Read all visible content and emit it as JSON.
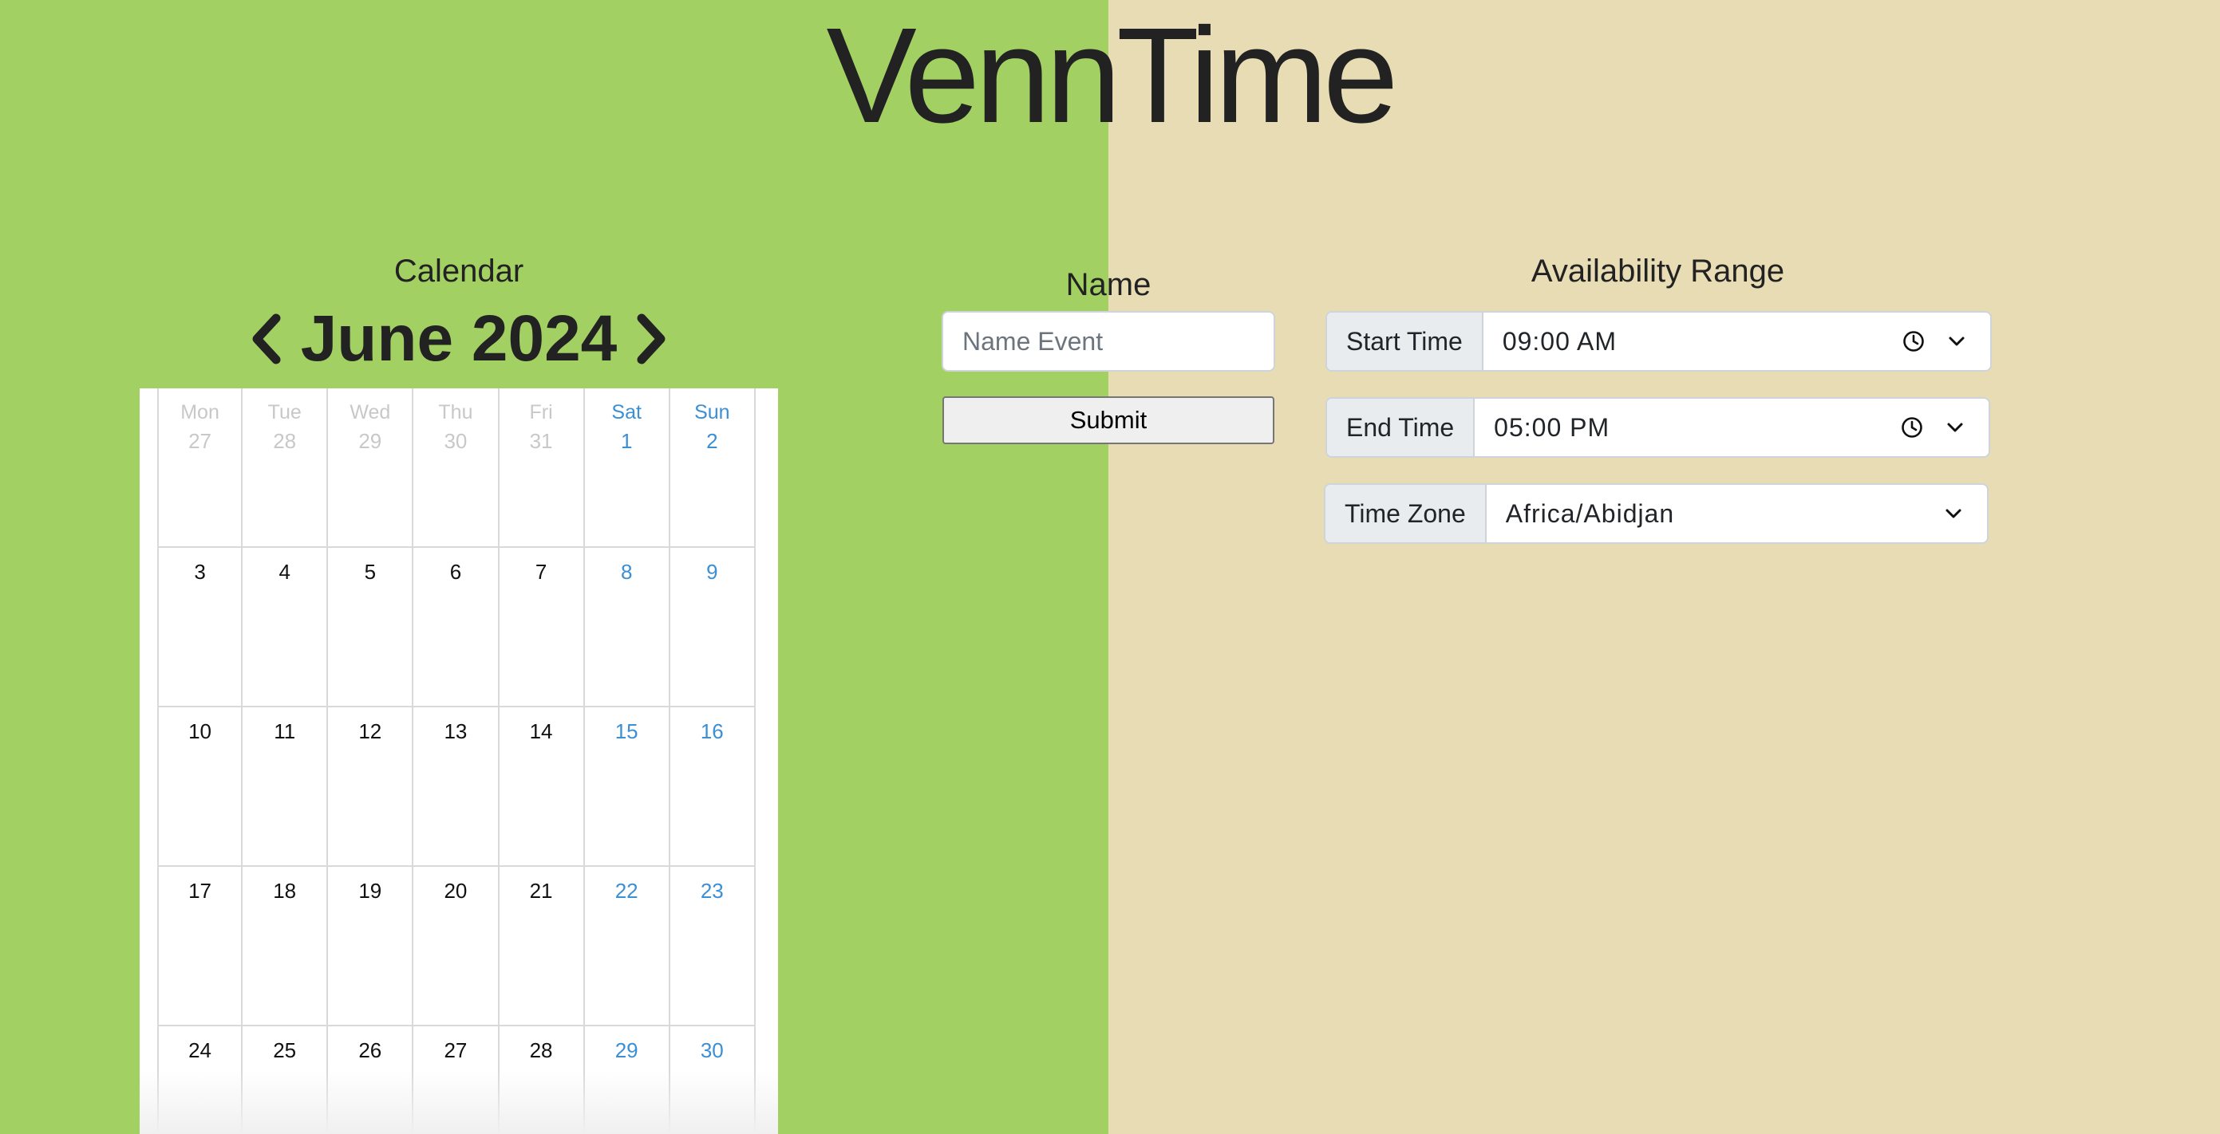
{
  "app": {
    "title": "VennTime"
  },
  "calendar": {
    "label": "Calendar",
    "month_title": "June 2024",
    "weeks": [
      [
        {
          "dow": "Mon",
          "day": "27",
          "kind": "other"
        },
        {
          "dow": "Tue",
          "day": "28",
          "kind": "other"
        },
        {
          "dow": "Wed",
          "day": "29",
          "kind": "other"
        },
        {
          "dow": "Thu",
          "day": "30",
          "kind": "other"
        },
        {
          "dow": "Fri",
          "day": "31",
          "kind": "other"
        },
        {
          "dow": "Sat",
          "day": "1",
          "kind": "weekend"
        },
        {
          "dow": "Sun",
          "day": "2",
          "kind": "weekend"
        }
      ],
      [
        {
          "day": "3"
        },
        {
          "day": "4"
        },
        {
          "day": "5"
        },
        {
          "day": "6"
        },
        {
          "day": "7"
        },
        {
          "day": "8",
          "kind": "weekend"
        },
        {
          "day": "9",
          "kind": "weekend"
        }
      ],
      [
        {
          "day": "10"
        },
        {
          "day": "11"
        },
        {
          "day": "12"
        },
        {
          "day": "13"
        },
        {
          "day": "14"
        },
        {
          "day": "15",
          "kind": "weekend"
        },
        {
          "day": "16",
          "kind": "weekend"
        }
      ],
      [
        {
          "day": "17"
        },
        {
          "day": "18"
        },
        {
          "day": "19"
        },
        {
          "day": "20"
        },
        {
          "day": "21"
        },
        {
          "day": "22",
          "kind": "weekend"
        },
        {
          "day": "23",
          "kind": "weekend"
        }
      ],
      [
        {
          "day": "24"
        },
        {
          "day": "25"
        },
        {
          "day": "26"
        },
        {
          "day": "27"
        },
        {
          "day": "28"
        },
        {
          "day": "29",
          "kind": "weekend"
        },
        {
          "day": "30",
          "kind": "weekend"
        }
      ]
    ]
  },
  "name_form": {
    "label": "Name",
    "placeholder": "Name Event",
    "value": "",
    "submit_label": "Submit"
  },
  "availability": {
    "label": "Availability Range",
    "start_label": "Start Time",
    "start_value": "09:00 AM",
    "end_label": "End Time",
    "end_value": "05:00 PM",
    "tz_label": "Time Zone",
    "tz_value": "Africa/Abidjan"
  },
  "colors": {
    "left_bg": "#a3d063",
    "right_bg": "#e8dcb5",
    "weekend": "#3b8fd4",
    "other_month": "#c8c8c8"
  },
  "icons": {
    "prev": "chevron-left-icon",
    "next": "chevron-right-icon",
    "clock": "clock-icon",
    "dropdown": "chevron-down-icon"
  }
}
